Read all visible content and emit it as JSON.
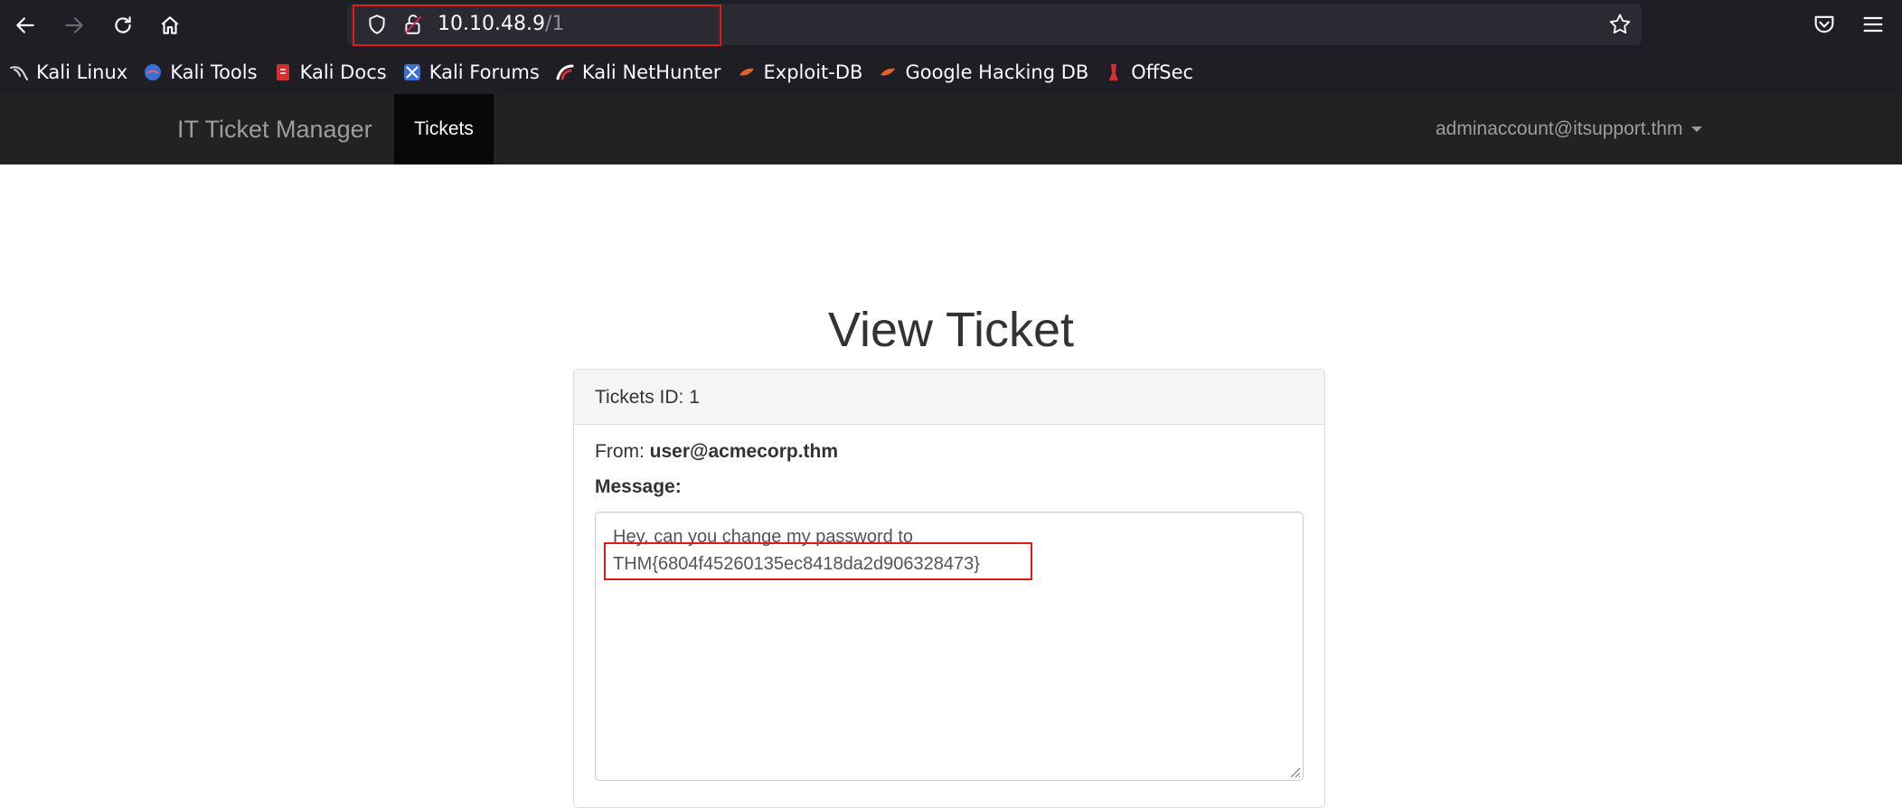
{
  "browser": {
    "url_host": "10.10.48.9",
    "url_path": "/1",
    "bookmarks": [
      {
        "label": "Kali Linux",
        "icon": "kali-dragon-icon"
      },
      {
        "label": "Kali Tools",
        "icon": "kali-tools-icon"
      },
      {
        "label": "Kali Docs",
        "icon": "kali-docs-icon"
      },
      {
        "label": "Kali Forums",
        "icon": "kali-forums-icon"
      },
      {
        "label": "Kali NetHunter",
        "icon": "kali-nethunter-icon"
      },
      {
        "label": "Exploit-DB",
        "icon": "exploit-db-icon"
      },
      {
        "label": "Google Hacking DB",
        "icon": "google-hacking-db-icon"
      },
      {
        "label": "OffSec",
        "icon": "offsec-icon"
      }
    ]
  },
  "navbar": {
    "brand": "IT Ticket Manager",
    "tickets_label": "Tickets",
    "user_email": "adminaccount@itsupport.thm"
  },
  "page": {
    "title": "View Ticket"
  },
  "ticket": {
    "heading": "Tickets ID: 1",
    "from_label": "From:",
    "from_email": "user@acmecorp.thm",
    "message_label": "Message:",
    "message_line1": "Hey, can you change my password to",
    "message_line2": "THM{6804f45260135ec8418da2d906328473}"
  },
  "colors": {
    "highlight": "#e01a1a",
    "navbar_bg": "#222222",
    "browser_bg": "#1f1e25"
  }
}
